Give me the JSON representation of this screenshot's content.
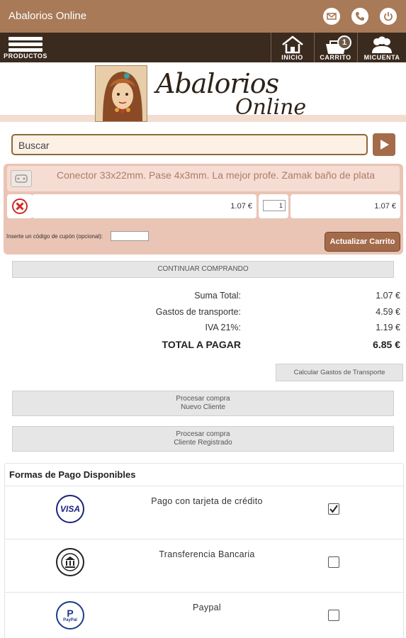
{
  "appbar": {
    "title": "Abalorios Online",
    "icons": [
      "mail-icon",
      "phone-icon",
      "power-icon"
    ]
  },
  "navbar": {
    "products_label": "PRODUCTOS",
    "home_label": "INICIO",
    "cart_label": "CARRITO",
    "cart_count": "1",
    "account_label": "MICUENTA"
  },
  "logo": {
    "line1": "Abalorios",
    "line2": "Online"
  },
  "search": {
    "value": "Buscar"
  },
  "cart": {
    "item": {
      "name": "Conector 33x22mm. Pase 4x3mm. La mejor profe. Zamak baño de plata",
      "unit_price": "1.07 €",
      "quantity": "1",
      "line_total": "1.07 €"
    },
    "coupon_label": "Inserte un código de cupón (opcional):",
    "coupon_value": "",
    "update_button": "Actualizar Carrito"
  },
  "continue_button": "CONTINUAR COMPRANDO",
  "totals": {
    "subtotal_label": "Suma Total:",
    "subtotal_value": "1.07 €",
    "shipping_label": "Gastos de transporte:",
    "shipping_value": "4.59 €",
    "vat_label": "IVA 21%:",
    "vat_value": "1.19 €",
    "total_label": "TOTAL A PAGAR",
    "total_value": "6.85 €"
  },
  "calc_shipping_button": "Calcular Gastos de Transporte",
  "process_new": {
    "line1": "Procesar compra",
    "line2": "Nuevo Cliente"
  },
  "process_registered": {
    "line1": "Procesar compra",
    "line2": "Cliente Registrado"
  },
  "payment": {
    "title": "Formas de Pago Disponibles",
    "methods": [
      {
        "name": "Pago con tarjeta de crédito",
        "icon": "visa-icon",
        "logo_text": "VISA",
        "checked": true
      },
      {
        "name": "Transferencia Bancaria",
        "icon": "bank-transfer-icon",
        "checked": false
      },
      {
        "name": "Paypal",
        "icon": "paypal-icon",
        "logo_text": "PayPal",
        "checked": false
      }
    ]
  },
  "colors": {
    "appbar": "#a87a57",
    "navbar": "#3b2a1e",
    "cart_panel": "#eac4b4",
    "accent_button": "#a46b4b"
  }
}
